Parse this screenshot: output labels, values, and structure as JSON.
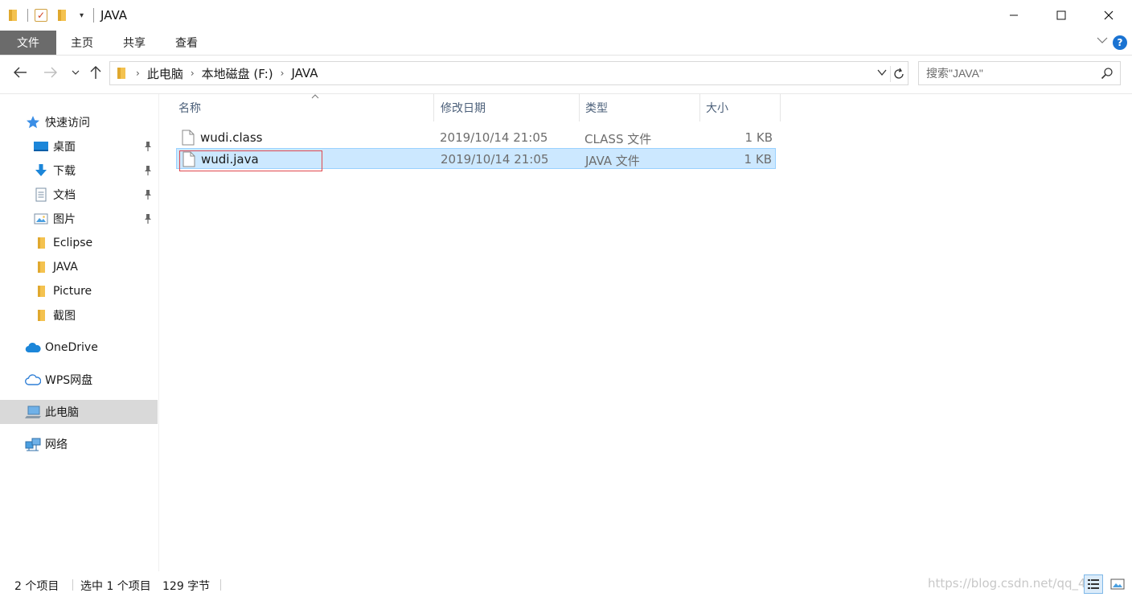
{
  "window": {
    "title": "JAVA",
    "controls": {
      "minimize": "minimize-icon",
      "maximize": "maximize-icon",
      "close": "close-icon"
    }
  },
  "ribbon": {
    "tabs": [
      "文件",
      "主页",
      "共享",
      "查看"
    ],
    "help_label": "?"
  },
  "nav": {
    "breadcrumb": [
      "此电脑",
      "本地磁盘 (F:)",
      "JAVA"
    ],
    "search_placeholder": "搜索\"JAVA\""
  },
  "sidebar": {
    "items": [
      {
        "label": "快速访问",
        "icon": "star-icon",
        "pinned": false
      },
      {
        "label": "桌面",
        "icon": "desktop-icon",
        "pinned": true
      },
      {
        "label": "下载",
        "icon": "download-icon",
        "pinned": true
      },
      {
        "label": "文档",
        "icon": "document-icon",
        "pinned": true
      },
      {
        "label": "图片",
        "icon": "picture-icon",
        "pinned": true
      },
      {
        "label": "Eclipse",
        "icon": "folder-icon",
        "pinned": false
      },
      {
        "label": "JAVA",
        "icon": "folder-icon",
        "pinned": false
      },
      {
        "label": "Picture",
        "icon": "folder-icon",
        "pinned": false
      },
      {
        "label": "截图",
        "icon": "folder-icon",
        "pinned": false
      },
      {
        "label": "OneDrive",
        "icon": "cloud-icon",
        "pinned": false
      },
      {
        "label": "WPS网盘",
        "icon": "cloud-outline-icon",
        "pinned": false
      },
      {
        "label": "此电脑",
        "icon": "computer-icon",
        "pinned": false,
        "selected": true
      },
      {
        "label": "网络",
        "icon": "network-icon",
        "pinned": false
      }
    ]
  },
  "filelist": {
    "columns": [
      "名称",
      "修改日期",
      "类型",
      "大小"
    ],
    "rows": [
      {
        "name": "wudi.class",
        "date": "2019/10/14 21:05",
        "type": "CLASS 文件",
        "size": "1 KB",
        "selected": false
      },
      {
        "name": "wudi.java",
        "date": "2019/10/14 21:05",
        "type": "JAVA 文件",
        "size": "1 KB",
        "selected": true
      }
    ]
  },
  "status": {
    "count": "2 个项目",
    "selection": "选中 1 个项目",
    "bytes": "129 字节",
    "watermark": "https://blog.csdn.net/qq_45"
  },
  "colors": {
    "file_tab": "#6b6b6b",
    "selection_fill": "#cce8ff",
    "selection_border": "#99d1ff",
    "rename_box": "#e0474c",
    "folder": "#f4c24f",
    "help": "#1a73d2"
  }
}
